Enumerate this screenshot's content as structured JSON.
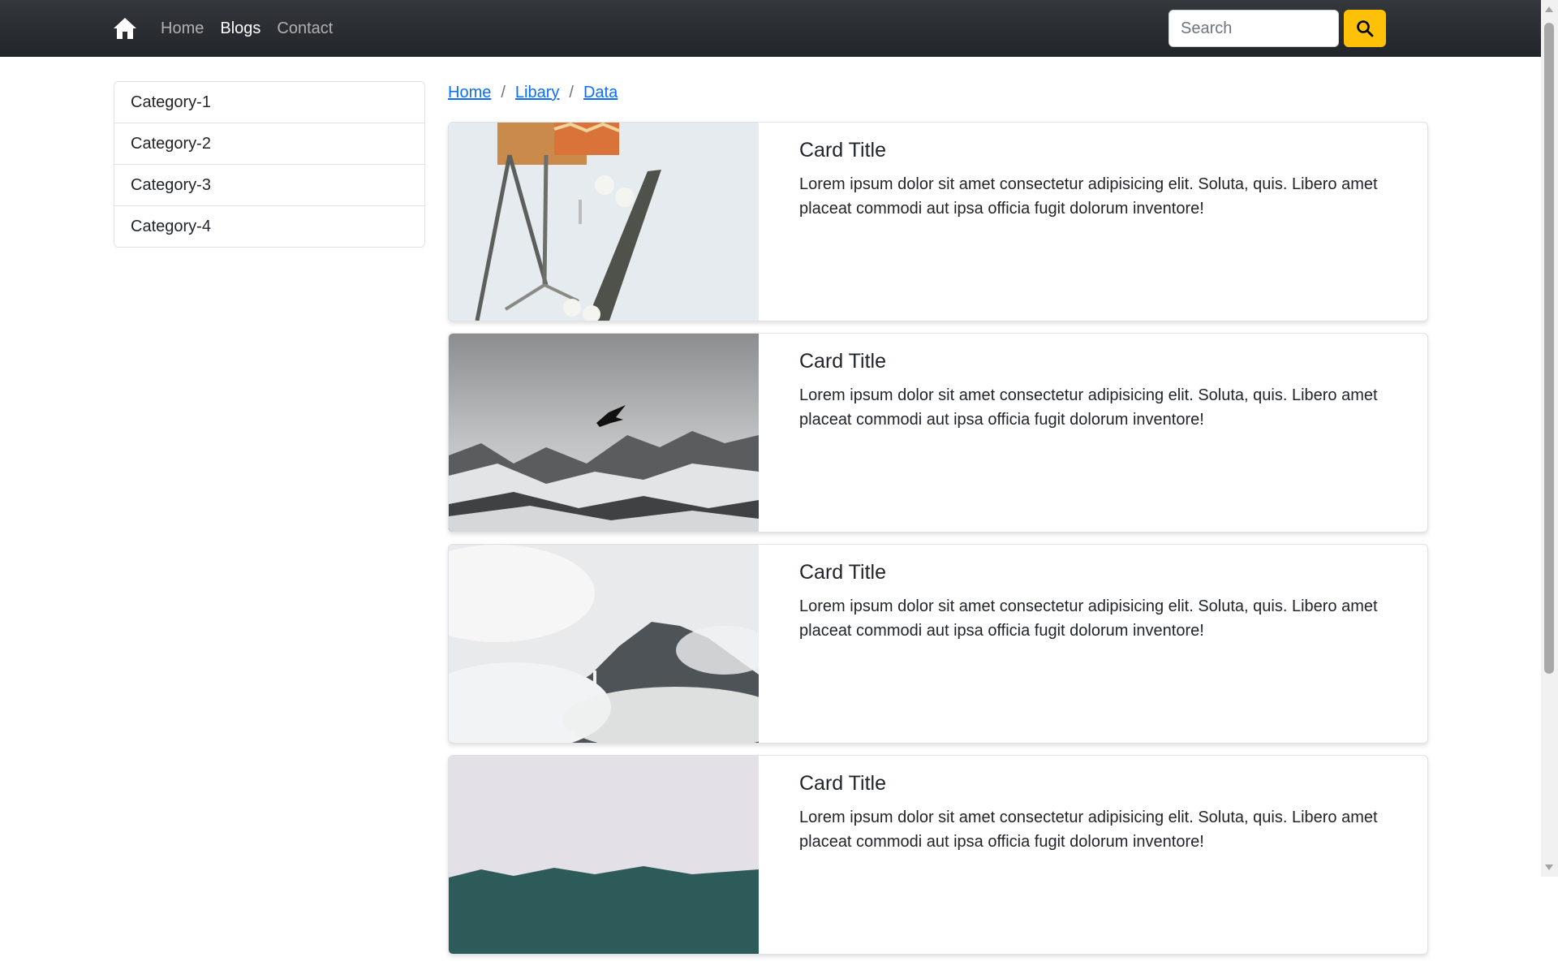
{
  "navbar": {
    "brand_icon": "home-icon",
    "links": [
      {
        "label": "Home",
        "active": false
      },
      {
        "label": "Blogs",
        "active": true
      },
      {
        "label": "Contact",
        "active": false
      }
    ],
    "search": {
      "placeholder": "Search",
      "value": "",
      "button_icon": "search-icon"
    },
    "colors": {
      "background": "#212529",
      "search_button": "#ffc107"
    }
  },
  "sidebar": {
    "items": [
      {
        "label": "Category-1"
      },
      {
        "label": "Category-2"
      },
      {
        "label": "Category-3"
      },
      {
        "label": "Category-4"
      }
    ]
  },
  "breadcrumb": {
    "separator": "/",
    "items": [
      {
        "label": "Home"
      },
      {
        "label": "Libary"
      },
      {
        "label": "Data"
      }
    ],
    "link_color": "#0d6efd"
  },
  "cards": [
    {
      "title": "Card Title",
      "text": "Lorem ipsum dolor sit amet consectetur adipisicing elit. Soluta, quis. Libero amet placeat commodi aut ipsa officia fugit dolorum inventore!",
      "image": "skateboard-photo"
    },
    {
      "title": "Card Title",
      "text": "Lorem ipsum dolor sit amet consectetur adipisicing elit. Soluta, quis. Libero amet placeat commodi aut ipsa officia fugit dolorum inventore!",
      "image": "bird-over-snowy-mountains-photo"
    },
    {
      "title": "Card Title",
      "text": "Lorem ipsum dolor sit amet consectetur adipisicing elit. Soluta, quis. Libero amet placeat commodi aut ipsa officia fugit dolorum inventore!",
      "image": "misty-mountain-waterfall-photo"
    },
    {
      "title": "Card Title",
      "text": "Lorem ipsum dolor sit amet consectetur adipisicing elit. Soluta, quis. Libero amet placeat commodi aut ipsa officia fugit dolorum inventore!",
      "image": "foggy-forest-photo"
    }
  ]
}
